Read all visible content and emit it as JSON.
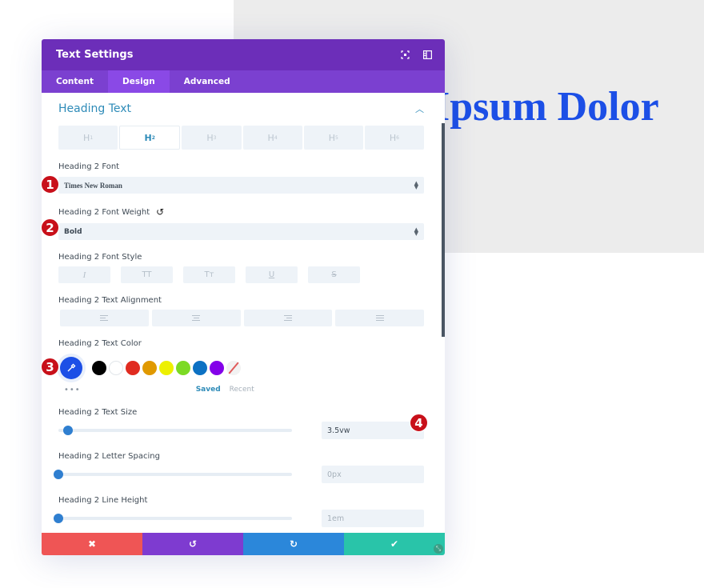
{
  "preview": {
    "heading_text": "Ipsum Dolor"
  },
  "modal": {
    "title": "Text Settings",
    "icons": {
      "fullscreen": "fullscreen-icon",
      "sidebar": "sidebar-layout-icon"
    },
    "tabs": [
      {
        "label": "Content",
        "active": false
      },
      {
        "label": "Design",
        "active": true
      },
      {
        "label": "Advanced",
        "active": false
      }
    ],
    "section": {
      "title": "Heading Text",
      "collapse_icon": "chevron-up-icon",
      "heading_tabs": [
        {
          "label": "H",
          "sub": "1",
          "active": false
        },
        {
          "label": "H",
          "sub": "2",
          "active": true
        },
        {
          "label": "H",
          "sub": "3",
          "active": false
        },
        {
          "label": "H",
          "sub": "4",
          "active": false
        },
        {
          "label": "H",
          "sub": "5",
          "active": false
        },
        {
          "label": "H",
          "sub": "6",
          "active": false
        }
      ],
      "font": {
        "label": "Heading 2 Font",
        "value": "Times New Roman"
      },
      "font_weight": {
        "label": "Heading 2 Font Weight",
        "value": "Bold"
      },
      "font_style": {
        "label": "Heading 2 Font Style",
        "buttons": [
          {
            "name": "italic",
            "glyph": "I"
          },
          {
            "name": "uppercase",
            "glyph": "TT"
          },
          {
            "name": "capitalize",
            "glyph": "Tт"
          },
          {
            "name": "underline",
            "glyph": "U"
          },
          {
            "name": "strikethrough",
            "glyph": "S"
          }
        ]
      },
      "text_alignment": {
        "label": "Heading 2 Text Alignment",
        "options": [
          "left",
          "center",
          "right",
          "justify"
        ]
      },
      "text_color": {
        "label": "Heading 2 Text Color",
        "current": "#1c4fe6",
        "swatches": [
          "#000000",
          "#ffffff",
          "#e02b20",
          "#e09900",
          "#edf000",
          "#7cda24",
          "#0c71c3",
          "#8300e9",
          "transparent"
        ],
        "saved_label": "Saved",
        "recent_label": "Recent"
      },
      "text_size": {
        "label": "Heading 2 Text Size",
        "value": "3.5vw",
        "slider_fraction": 0.04
      },
      "letter_spacing": {
        "label": "Heading 2 Letter Spacing",
        "placeholder": "0px",
        "slider_fraction": 0.0
      },
      "line_height": {
        "label": "Heading 2 Line Height",
        "placeholder": "1em",
        "slider_fraction": 0.0
      }
    },
    "footer": {
      "cancel": {
        "icon": "✖",
        "color": "#ef5555"
      },
      "undo": {
        "icon": "↺",
        "color": "#7e3bd0"
      },
      "redo": {
        "icon": "↻",
        "color": "#2b87da"
      },
      "save": {
        "icon": "✔",
        "color": "#29c4a9"
      }
    }
  },
  "annotations": [
    "1",
    "2",
    "3",
    "4"
  ]
}
